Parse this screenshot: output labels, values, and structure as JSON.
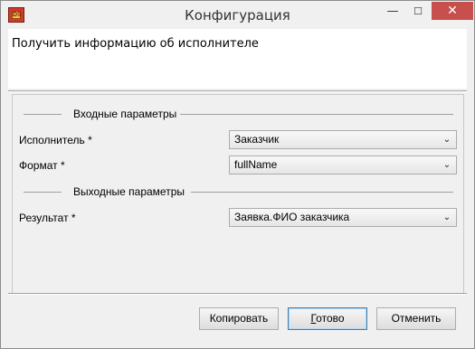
{
  "window": {
    "title": "Конфигурация",
    "app_icon_text": "DS",
    "controls": {
      "minimize": "—",
      "maximize": "☐",
      "close": "✕"
    }
  },
  "header": {
    "title": "Получить информацию об исполнителе"
  },
  "input_group": {
    "label": "Входные параметры",
    "fields": [
      {
        "label": "Исполнитель *",
        "value": "Заказчик"
      },
      {
        "label": "Формат *",
        "value": "fullName"
      }
    ]
  },
  "output_group": {
    "label": "Выходные параметры",
    "fields": [
      {
        "label": "Результат *",
        "value": "Заявка.ФИО заказчика"
      }
    ]
  },
  "buttons": {
    "copy": "Копировать",
    "ok_first": "Г",
    "ok_rest": "отово",
    "cancel": "Отменить"
  },
  "icons": {
    "dropdown": "chevron-down-icon",
    "chevron_glyph": "⌄"
  }
}
